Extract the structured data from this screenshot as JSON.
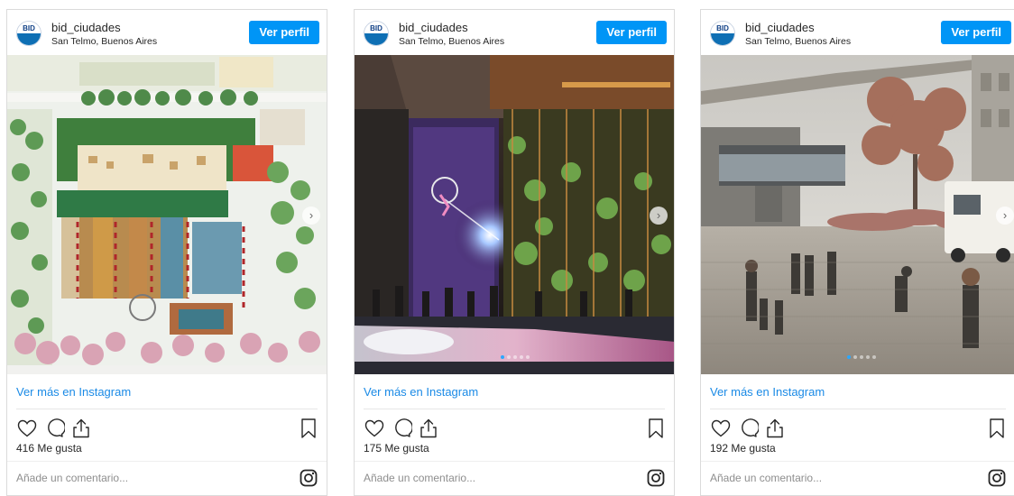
{
  "posts": [
    {
      "username": "bid_ciudades",
      "location": "San Telmo, Buenos Aires",
      "profile_button": "Ver perfil",
      "avatar_text": "BID",
      "more_link": "Ver más en Instagram",
      "likes": "416 Me gusta",
      "comment_placeholder": "Añade un comentario...",
      "image_subject": "site plan illustration"
    },
    {
      "username": "bid_ciudades",
      "location": "San Telmo, Buenos Aires",
      "profile_button": "Ver perfil",
      "avatar_text": "BID",
      "more_link": "Ver más en Instagram",
      "likes": "175 Me gusta",
      "comment_placeholder": "Añade un comentario...",
      "image_subject": "underpass night rendering"
    },
    {
      "username": "bid_ciudades",
      "location": "San Telmo, Buenos Aires",
      "profile_button": "Ver perfil",
      "avatar_text": "BID",
      "more_link": "Ver más en Instagram",
      "likes": "192 Me gusta",
      "comment_placeholder": "Añade un comentario...",
      "image_subject": "plaza street rendering"
    }
  ],
  "icons": [
    "heart-icon",
    "comment-icon",
    "share-icon",
    "bookmark-icon",
    "instagram-icon",
    "chevron-right-icon"
  ],
  "colors": {
    "accent": "#0095f6",
    "link": "#1a8ae6",
    "carousel_dot_active": "#2aa7ff"
  }
}
